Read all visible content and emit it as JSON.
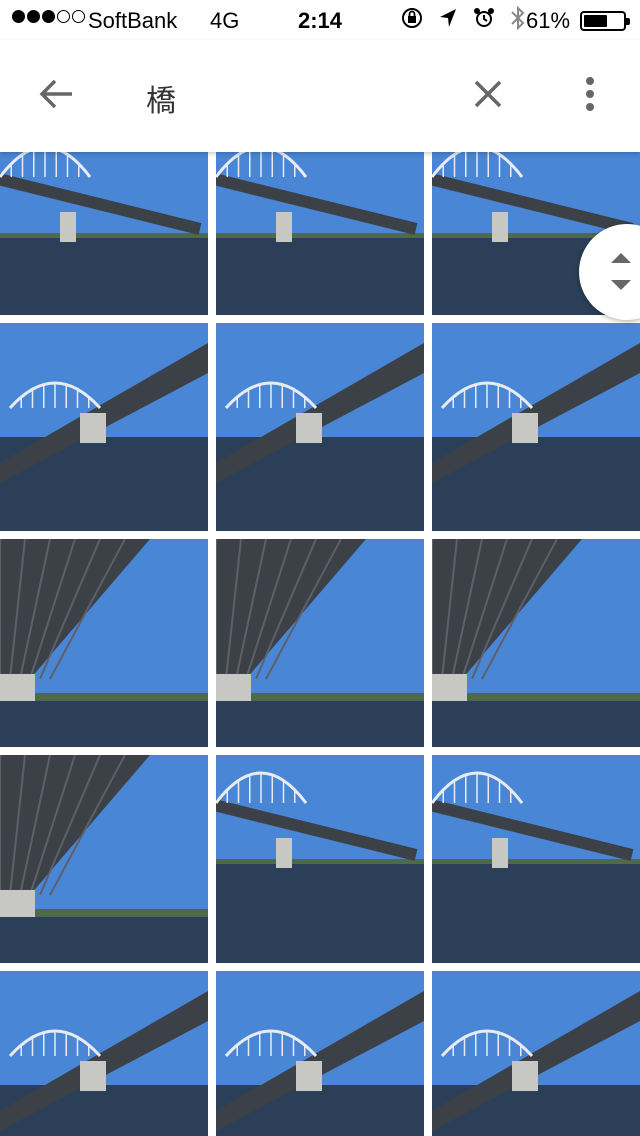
{
  "status_bar": {
    "carrier": "SoftBank",
    "network": "4G",
    "time": "2:14",
    "battery_percent": "61%",
    "battery_level": 0.61,
    "signal_bars_filled": 3,
    "signal_bars_total": 5,
    "icons": [
      "rotation-lock-icon",
      "location-arrow-icon",
      "alarm-clock-icon",
      "bluetooth-icon"
    ]
  },
  "app_bar": {
    "back_icon": "arrow-back-icon",
    "search_query": "橋",
    "clear_icon": "close-icon",
    "more_icon": "more-vert-icon"
  },
  "results": {
    "photo_count_visible": 15,
    "photos": [
      {
        "subject": "arch bridge over water"
      },
      {
        "subject": "arch bridge over water"
      },
      {
        "subject": "arch bridge over water"
      },
      {
        "subject": "bridge underside with pier"
      },
      {
        "subject": "bridge underside with pier"
      },
      {
        "subject": "arch bridge with pier"
      },
      {
        "subject": "bridge underside"
      },
      {
        "subject": "bridge underside"
      },
      {
        "subject": "bridge underside"
      },
      {
        "subject": "bridge underside with pier"
      },
      {
        "subject": "arch bridge over water"
      },
      {
        "subject": "arch bridge over water"
      },
      {
        "subject": "arch bridge with piers"
      },
      {
        "subject": "bridge underside with piers"
      },
      {
        "subject": "arch bridge with piers"
      }
    ]
  },
  "fast_scroll": {
    "icon": "fast-scroll-handle-icon"
  },
  "colors": {
    "sky": "#4a86d6",
    "water": "#2b3f58",
    "bridge": "#3c4047",
    "pier": "#c7c8c4",
    "accent_icon": "#666666"
  }
}
